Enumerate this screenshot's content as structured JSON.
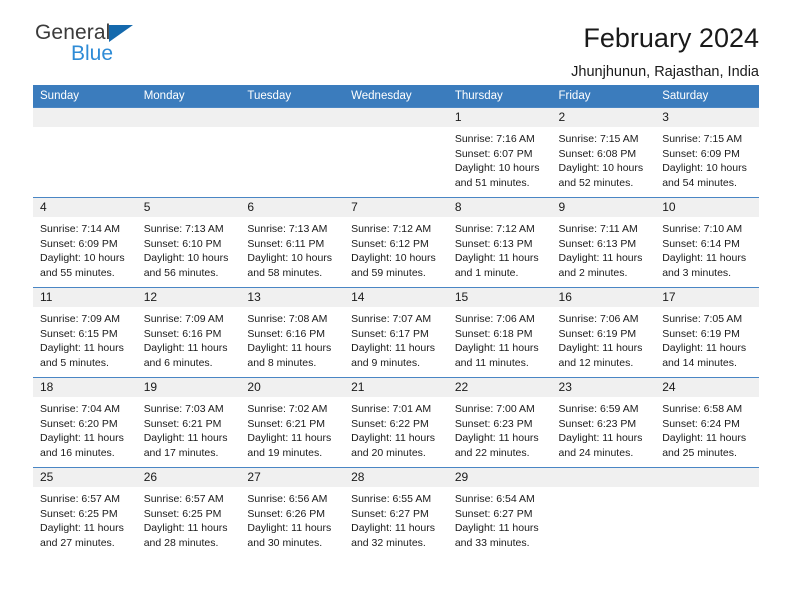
{
  "brand": {
    "line1": "General",
    "line2": "Blue",
    "logo_icon": "triangle-logo-icon",
    "accent_color": "#1469ad",
    "blue_text_color": "#2e8bd6"
  },
  "header": {
    "title": "February 2024",
    "subtitle": "Jhunjhunun, Rajasthan, India"
  },
  "calendar": {
    "header_bg": "#3b7cbd",
    "daynum_bg": "#f0f0f0",
    "weekday_headers": [
      "Sunday",
      "Monday",
      "Tuesday",
      "Wednesday",
      "Thursday",
      "Friday",
      "Saturday"
    ],
    "weeks": [
      [
        {
          "day": "",
          "empty": true,
          "sunrise": "",
          "sunset": "",
          "daylight_1": "",
          "daylight_2": ""
        },
        {
          "day": "",
          "empty": true,
          "sunrise": "",
          "sunset": "",
          "daylight_1": "",
          "daylight_2": ""
        },
        {
          "day": "",
          "empty": true,
          "sunrise": "",
          "sunset": "",
          "daylight_1": "",
          "daylight_2": ""
        },
        {
          "day": "",
          "empty": true,
          "sunrise": "",
          "sunset": "",
          "daylight_1": "",
          "daylight_2": ""
        },
        {
          "day": "1",
          "empty": false,
          "sunrise": "Sunrise: 7:16 AM",
          "sunset": "Sunset: 6:07 PM",
          "daylight_1": "Daylight: 10 hours",
          "daylight_2": "and 51 minutes."
        },
        {
          "day": "2",
          "empty": false,
          "sunrise": "Sunrise: 7:15 AM",
          "sunset": "Sunset: 6:08 PM",
          "daylight_1": "Daylight: 10 hours",
          "daylight_2": "and 52 minutes."
        },
        {
          "day": "3",
          "empty": false,
          "sunrise": "Sunrise: 7:15 AM",
          "sunset": "Sunset: 6:09 PM",
          "daylight_1": "Daylight: 10 hours",
          "daylight_2": "and 54 minutes."
        }
      ],
      [
        {
          "day": "4",
          "empty": false,
          "sunrise": "Sunrise: 7:14 AM",
          "sunset": "Sunset: 6:09 PM",
          "daylight_1": "Daylight: 10 hours",
          "daylight_2": "and 55 minutes."
        },
        {
          "day": "5",
          "empty": false,
          "sunrise": "Sunrise: 7:13 AM",
          "sunset": "Sunset: 6:10 PM",
          "daylight_1": "Daylight: 10 hours",
          "daylight_2": "and 56 minutes."
        },
        {
          "day": "6",
          "empty": false,
          "sunrise": "Sunrise: 7:13 AM",
          "sunset": "Sunset: 6:11 PM",
          "daylight_1": "Daylight: 10 hours",
          "daylight_2": "and 58 minutes."
        },
        {
          "day": "7",
          "empty": false,
          "sunrise": "Sunrise: 7:12 AM",
          "sunset": "Sunset: 6:12 PM",
          "daylight_1": "Daylight: 10 hours",
          "daylight_2": "and 59 minutes."
        },
        {
          "day": "8",
          "empty": false,
          "sunrise": "Sunrise: 7:12 AM",
          "sunset": "Sunset: 6:13 PM",
          "daylight_1": "Daylight: 11 hours",
          "daylight_2": "and 1 minute."
        },
        {
          "day": "9",
          "empty": false,
          "sunrise": "Sunrise: 7:11 AM",
          "sunset": "Sunset: 6:13 PM",
          "daylight_1": "Daylight: 11 hours",
          "daylight_2": "and 2 minutes."
        },
        {
          "day": "10",
          "empty": false,
          "sunrise": "Sunrise: 7:10 AM",
          "sunset": "Sunset: 6:14 PM",
          "daylight_1": "Daylight: 11 hours",
          "daylight_2": "and 3 minutes."
        }
      ],
      [
        {
          "day": "11",
          "empty": false,
          "sunrise": "Sunrise: 7:09 AM",
          "sunset": "Sunset: 6:15 PM",
          "daylight_1": "Daylight: 11 hours",
          "daylight_2": "and 5 minutes."
        },
        {
          "day": "12",
          "empty": false,
          "sunrise": "Sunrise: 7:09 AM",
          "sunset": "Sunset: 6:16 PM",
          "daylight_1": "Daylight: 11 hours",
          "daylight_2": "and 6 minutes."
        },
        {
          "day": "13",
          "empty": false,
          "sunrise": "Sunrise: 7:08 AM",
          "sunset": "Sunset: 6:16 PM",
          "daylight_1": "Daylight: 11 hours",
          "daylight_2": "and 8 minutes."
        },
        {
          "day": "14",
          "empty": false,
          "sunrise": "Sunrise: 7:07 AM",
          "sunset": "Sunset: 6:17 PM",
          "daylight_1": "Daylight: 11 hours",
          "daylight_2": "and 9 minutes."
        },
        {
          "day": "15",
          "empty": false,
          "sunrise": "Sunrise: 7:06 AM",
          "sunset": "Sunset: 6:18 PM",
          "daylight_1": "Daylight: 11 hours",
          "daylight_2": "and 11 minutes."
        },
        {
          "day": "16",
          "empty": false,
          "sunrise": "Sunrise: 7:06 AM",
          "sunset": "Sunset: 6:19 PM",
          "daylight_1": "Daylight: 11 hours",
          "daylight_2": "and 12 minutes."
        },
        {
          "day": "17",
          "empty": false,
          "sunrise": "Sunrise: 7:05 AM",
          "sunset": "Sunset: 6:19 PM",
          "daylight_1": "Daylight: 11 hours",
          "daylight_2": "and 14 minutes."
        }
      ],
      [
        {
          "day": "18",
          "empty": false,
          "sunrise": "Sunrise: 7:04 AM",
          "sunset": "Sunset: 6:20 PM",
          "daylight_1": "Daylight: 11 hours",
          "daylight_2": "and 16 minutes."
        },
        {
          "day": "19",
          "empty": false,
          "sunrise": "Sunrise: 7:03 AM",
          "sunset": "Sunset: 6:21 PM",
          "daylight_1": "Daylight: 11 hours",
          "daylight_2": "and 17 minutes."
        },
        {
          "day": "20",
          "empty": false,
          "sunrise": "Sunrise: 7:02 AM",
          "sunset": "Sunset: 6:21 PM",
          "daylight_1": "Daylight: 11 hours",
          "daylight_2": "and 19 minutes."
        },
        {
          "day": "21",
          "empty": false,
          "sunrise": "Sunrise: 7:01 AM",
          "sunset": "Sunset: 6:22 PM",
          "daylight_1": "Daylight: 11 hours",
          "daylight_2": "and 20 minutes."
        },
        {
          "day": "22",
          "empty": false,
          "sunrise": "Sunrise: 7:00 AM",
          "sunset": "Sunset: 6:23 PM",
          "daylight_1": "Daylight: 11 hours",
          "daylight_2": "and 22 minutes."
        },
        {
          "day": "23",
          "empty": false,
          "sunrise": "Sunrise: 6:59 AM",
          "sunset": "Sunset: 6:23 PM",
          "daylight_1": "Daylight: 11 hours",
          "daylight_2": "and 24 minutes."
        },
        {
          "day": "24",
          "empty": false,
          "sunrise": "Sunrise: 6:58 AM",
          "sunset": "Sunset: 6:24 PM",
          "daylight_1": "Daylight: 11 hours",
          "daylight_2": "and 25 minutes."
        }
      ],
      [
        {
          "day": "25",
          "empty": false,
          "sunrise": "Sunrise: 6:57 AM",
          "sunset": "Sunset: 6:25 PM",
          "daylight_1": "Daylight: 11 hours",
          "daylight_2": "and 27 minutes."
        },
        {
          "day": "26",
          "empty": false,
          "sunrise": "Sunrise: 6:57 AM",
          "sunset": "Sunset: 6:25 PM",
          "daylight_1": "Daylight: 11 hours",
          "daylight_2": "and 28 minutes."
        },
        {
          "day": "27",
          "empty": false,
          "sunrise": "Sunrise: 6:56 AM",
          "sunset": "Sunset: 6:26 PM",
          "daylight_1": "Daylight: 11 hours",
          "daylight_2": "and 30 minutes."
        },
        {
          "day": "28",
          "empty": false,
          "sunrise": "Sunrise: 6:55 AM",
          "sunset": "Sunset: 6:27 PM",
          "daylight_1": "Daylight: 11 hours",
          "daylight_2": "and 32 minutes."
        },
        {
          "day": "29",
          "empty": false,
          "sunrise": "Sunrise: 6:54 AM",
          "sunset": "Sunset: 6:27 PM",
          "daylight_1": "Daylight: 11 hours",
          "daylight_2": "and 33 minutes."
        },
        {
          "day": "",
          "empty": true,
          "sunrise": "",
          "sunset": "",
          "daylight_1": "",
          "daylight_2": ""
        },
        {
          "day": "",
          "empty": true,
          "sunrise": "",
          "sunset": "",
          "daylight_1": "",
          "daylight_2": ""
        }
      ]
    ]
  }
}
